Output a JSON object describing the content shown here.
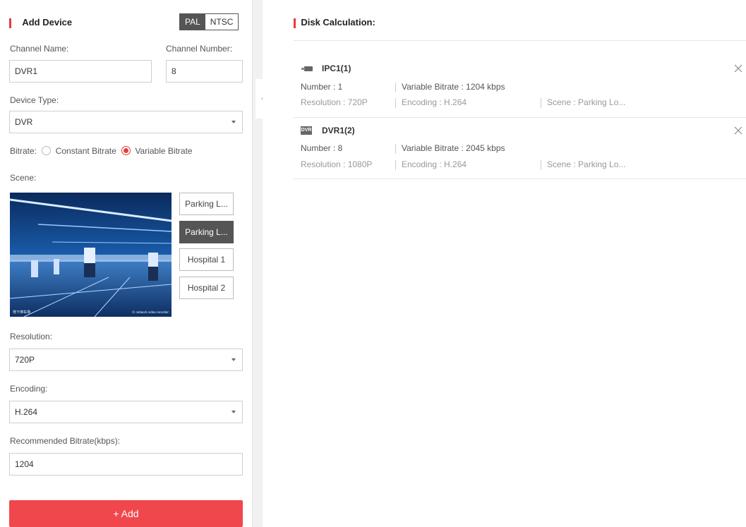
{
  "left": {
    "title": "Add Device",
    "standard": {
      "pal": "PAL",
      "ntsc": "NTSC",
      "selected": "PAL"
    },
    "channel_name": {
      "label": "Channel Name:",
      "value": "DVR1"
    },
    "channel_number": {
      "label": "Channel Number:",
      "value": "8"
    },
    "device_type": {
      "label": "Device Type:",
      "value": "DVR"
    },
    "bitrate": {
      "label": "Bitrate:",
      "constant": "Constant Bitrate",
      "variable": "Variable Bitrate",
      "selected": "Variable Bitrate"
    },
    "scene": {
      "label": "Scene:",
      "options": [
        "Parking L...",
        "Parking L...",
        "Hospital 1",
        "Hospital 2"
      ],
      "selected_index": 1,
      "image_caption_left": "地下停车场",
      "image_caption_right": "© network video recorder"
    },
    "resolution": {
      "label": "Resolution:",
      "value": "720P"
    },
    "encoding": {
      "label": "Encoding:",
      "value": "H.264"
    },
    "recommended_bitrate": {
      "label": "Recommended Bitrate(kbps):",
      "value": "1204"
    },
    "add_button": "+ Add"
  },
  "right": {
    "title": "Disk Calculation:",
    "devices": [
      {
        "icon": "ipc-camera-icon",
        "name": "IPC1(1)",
        "number": "Number : 1",
        "bitrate": "Variable Bitrate : 1204 kbps",
        "resolution": "Resolution : 720P",
        "encoding": "Encoding : H.264",
        "scene": "Scene : Parking Lo..."
      },
      {
        "icon": "dvr-icon",
        "icon_text": "DVR",
        "name": "DVR1(2)",
        "number": "Number : 8",
        "bitrate": "Variable Bitrate : 2045 kbps",
        "resolution": "Resolution : 1080P",
        "encoding": "Encoding : H.264",
        "scene": "Scene : Parking Lo..."
      }
    ]
  },
  "colors": {
    "accent": "#e83b3b",
    "add_button": "#f0474d",
    "toggle_active": "#555555"
  }
}
